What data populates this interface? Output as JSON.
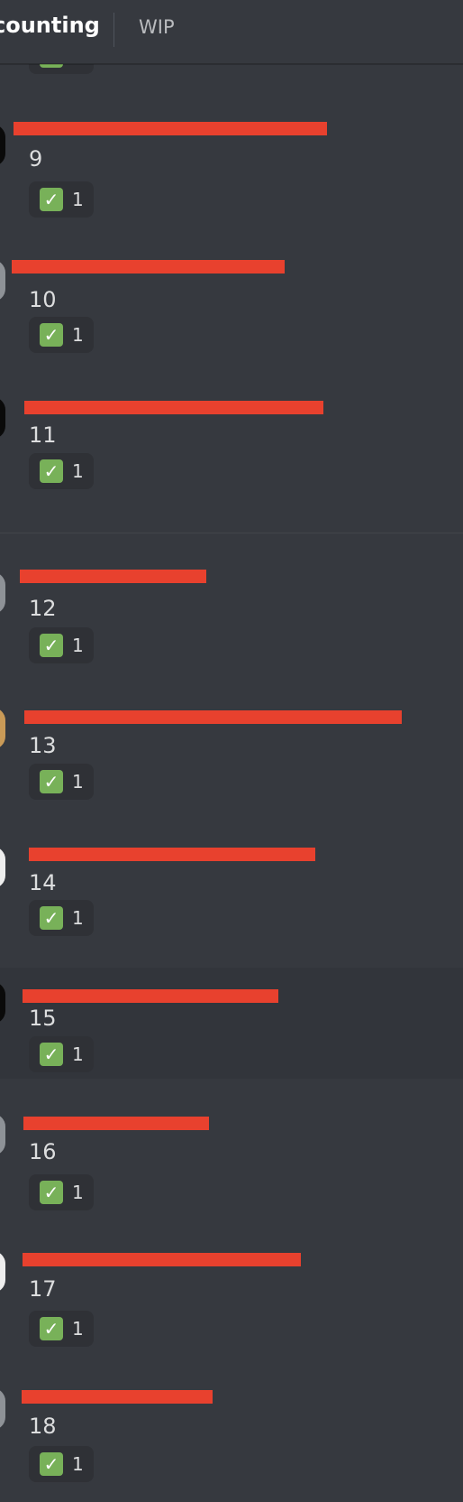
{
  "header": {
    "channel": "counting",
    "topic": "WIP"
  },
  "colors": {
    "background": "#36393f",
    "redaction": "#e8412e",
    "username_green": "#3ba55d",
    "username_blue": "#4ea6de",
    "reaction_bg": "#2f3136"
  },
  "top_partial_reaction": {
    "emoji_icon": "white-check-mark-icon",
    "count": "1"
  },
  "messages": [
    {
      "number": "9",
      "username": "",
      "timestamp": "",
      "emoji_icon": "white-check-mark-icon",
      "reaction_count": "1"
    },
    {
      "number": "10",
      "username": "",
      "timestamp": "",
      "emoji_icon": "white-check-mark-icon",
      "reaction_count": "1"
    },
    {
      "number": "11",
      "username": "",
      "timestamp": "",
      "emoji_icon": "white-check-mark-icon",
      "reaction_count": "1"
    },
    {
      "number": "12",
      "username": "",
      "timestamp": "",
      "emoji_icon": "white-check-mark-icon",
      "reaction_count": "1"
    },
    {
      "number": "13",
      "username": "",
      "timestamp": "",
      "emoji_icon": "white-check-mark-icon",
      "reaction_count": "1"
    },
    {
      "number": "14",
      "username": "",
      "timestamp": "",
      "emoji_icon": "white-check-mark-icon",
      "reaction_count": "1"
    },
    {
      "number": "15",
      "username": "",
      "timestamp": "",
      "emoji_icon": "white-check-mark-icon",
      "reaction_count": "1"
    },
    {
      "number": "16",
      "username": "",
      "timestamp": "",
      "emoji_icon": "white-check-mark-icon",
      "reaction_count": "1"
    },
    {
      "number": "17",
      "username": "",
      "timestamp": "",
      "emoji_icon": "white-check-mark-icon",
      "reaction_count": "1"
    },
    {
      "number": "18",
      "username": "",
      "timestamp": "",
      "emoji_icon": "white-check-mark-icon",
      "reaction_count": "1"
    }
  ]
}
